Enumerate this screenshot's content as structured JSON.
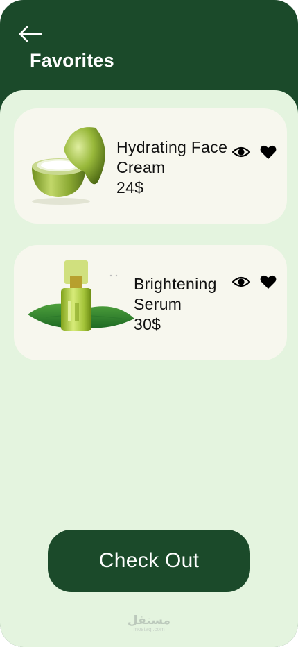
{
  "header": {
    "back_icon": "arrow-left-icon",
    "title": "Favorites"
  },
  "favorites": [
    {
      "name": "Hydrating Face Cream",
      "price": "24$",
      "image": "cream-jar-image",
      "actions": [
        "eye-icon",
        "heart-icon"
      ]
    },
    {
      "name": "Brightening Serum",
      "price": "30$",
      "image": "serum-bottle-image",
      "actions": [
        "eye-icon",
        "heart-icon"
      ]
    }
  ],
  "checkout": {
    "label": "Check Out"
  },
  "watermark": {
    "arabic": "مستقل",
    "latin": "mostaql.com"
  },
  "colors": {
    "primary_dark_green": "#1b4a2a",
    "background_mint": "#e4f4df",
    "card_cream": "#f7f7ee",
    "text": "#111111"
  }
}
